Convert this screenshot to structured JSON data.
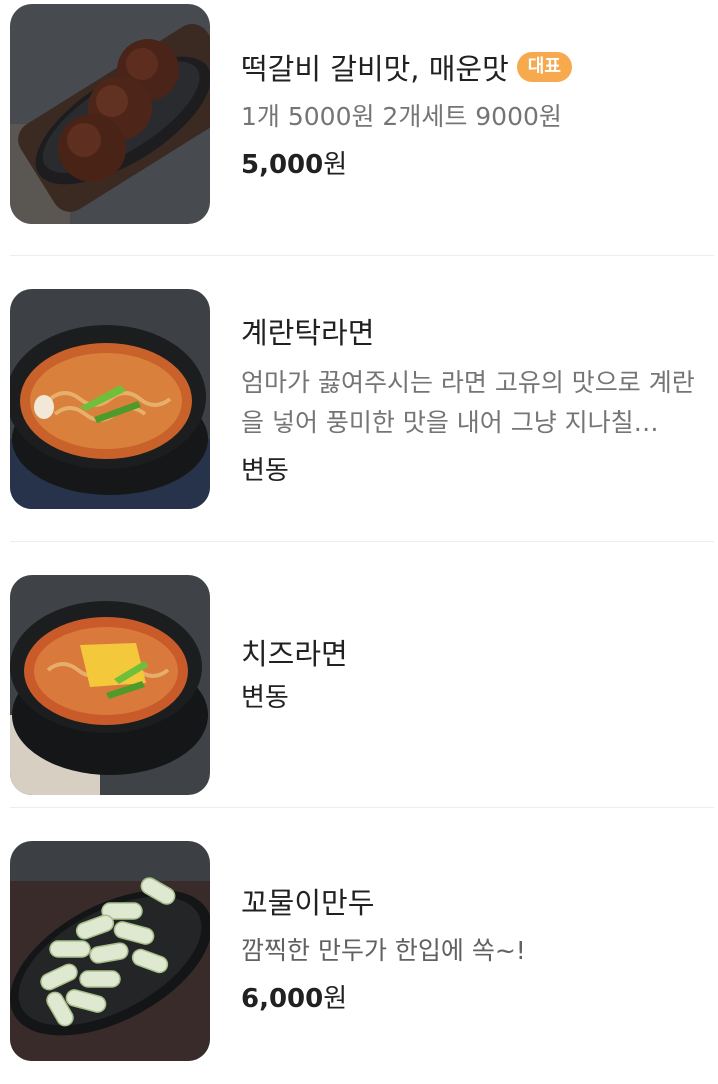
{
  "menu": {
    "items": [
      {
        "name": "떡갈비 갈비맛, 매운맛",
        "badge": "대표",
        "description": "1개 5000원 2개세트 9000원",
        "price_amount": "5,000",
        "price_unit": "원",
        "image_icon": "tteokgalbi-photo"
      },
      {
        "name": "계란탁라면",
        "description": "엄마가 끓여주시는 라면 고유의 맛으로 계란을 넣어 풍미한 맛을 내어 그냥 지나칠…",
        "price_text": "변동",
        "image_icon": "egg-ramen-photo"
      },
      {
        "name": "치즈라면",
        "price_text": "변동",
        "image_icon": "cheese-ramen-photo"
      },
      {
        "name": "꼬물이만두",
        "description": "깜찍한 만두가 한입에 쏙~!",
        "price_amount": "6,000",
        "price_unit": "원",
        "image_icon": "kkomuli-mandu-photo"
      }
    ]
  },
  "colors": {
    "badge": "#f7a94d",
    "title": "#212121",
    "description": "#757575",
    "divider": "#eeeeee"
  }
}
